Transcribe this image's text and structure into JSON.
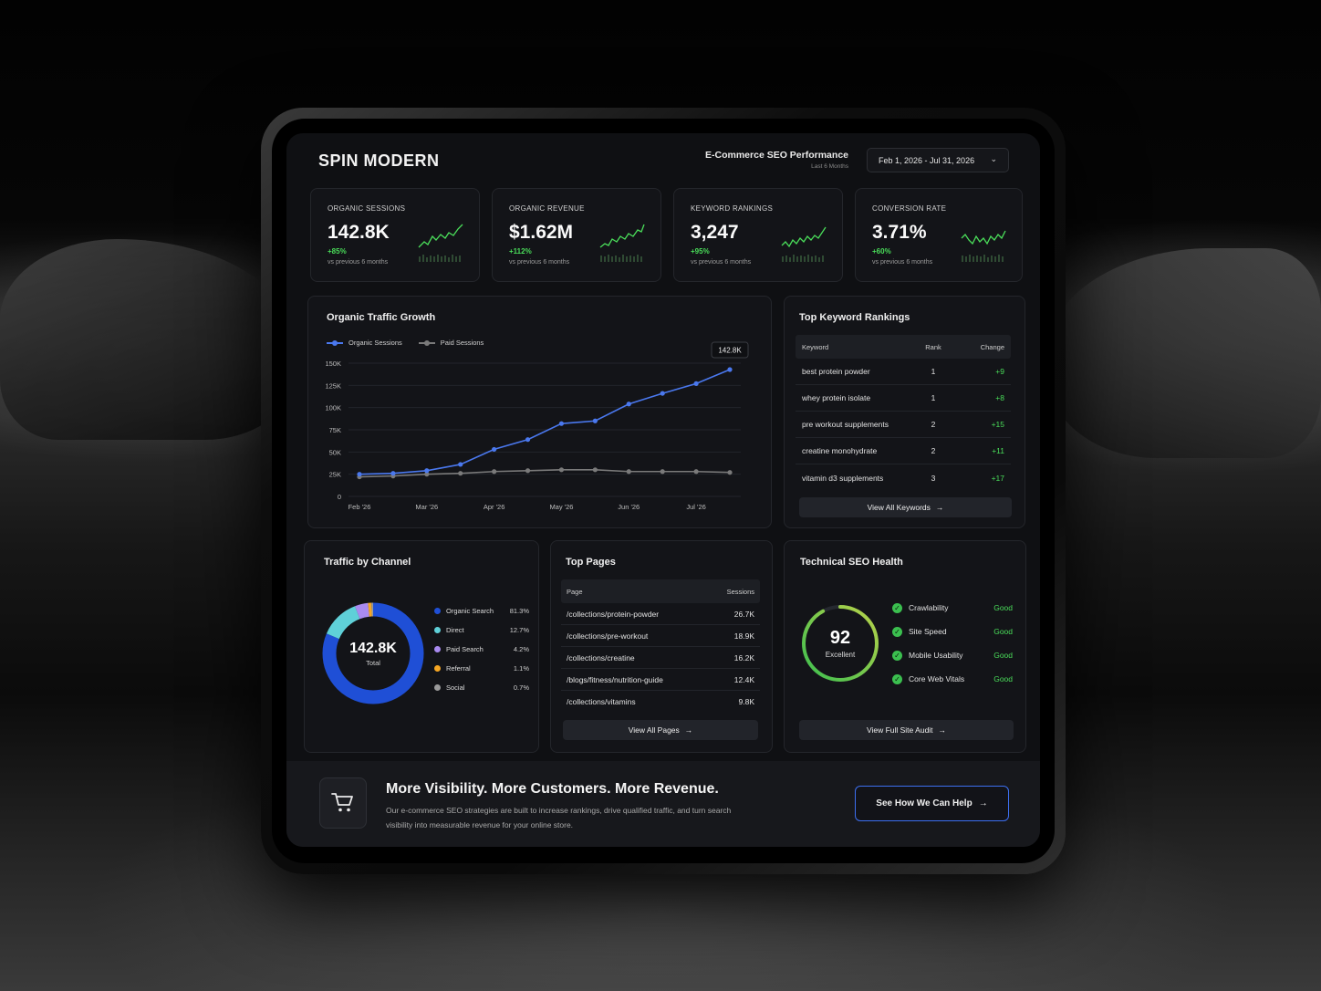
{
  "brand": "SPIN MODERN",
  "header": {
    "title": "E-Commerce SEO Performance",
    "subtitle": "Last 6 Months",
    "date_range": "Feb 1, 2026 - Jul 31, 2026"
  },
  "kpis": [
    {
      "label": "ORGANIC SESSIONS",
      "value": "142.8K",
      "change": "+85%",
      "note": "vs previous 6 months"
    },
    {
      "label": "ORGANIC REVENUE",
      "value": "$1.62M",
      "change": "+112%",
      "note": "vs previous 6 months"
    },
    {
      "label": "KEYWORD RANKINGS",
      "value": "3,247",
      "change": "+95%",
      "note": "vs previous 6 months"
    },
    {
      "label": "CONVERSION RATE",
      "value": "3.71%",
      "change": "+60%",
      "note": "vs previous 6 months"
    }
  ],
  "traffic": {
    "title": "Organic Traffic Growth",
    "tooltip": "142.8K"
  },
  "chart_data": {
    "type": "line",
    "title": "Organic Traffic Growth",
    "x": [
      "Feb '26",
      "",
      "Mar '26",
      "",
      "Apr '26",
      "",
      "May '26",
      "",
      "Jun '26",
      "",
      "Jul '26",
      ""
    ],
    "x_tick_labels": [
      "Feb '26",
      "Mar '26",
      "Apr '26",
      "May '26",
      "Jun '26",
      "Jul '26"
    ],
    "y_tick_labels": [
      "150K",
      "125K",
      "100K",
      "75K",
      "50K",
      "25K",
      "0"
    ],
    "ylim": [
      0,
      150000
    ],
    "series": [
      {
        "name": "Organic Sessions",
        "color": "#4a78ee",
        "values": [
          25000,
          26000,
          29000,
          36000,
          53000,
          64000,
          82000,
          85000,
          104000,
          116000,
          127000,
          142800
        ]
      },
      {
        "name": "Paid Sessions",
        "color": "#7a7a7a",
        "values": [
          22000,
          23000,
          25000,
          26000,
          28000,
          29000,
          30000,
          30000,
          28000,
          28000,
          28000,
          27000
        ]
      }
    ],
    "grid": true,
    "legend": "top-left"
  },
  "keywords": {
    "title": "Top Keyword Rankings",
    "headers": [
      "Keyword",
      "Rank",
      "Change"
    ],
    "rows": [
      {
        "keyword": "best protein powder",
        "rank": "1",
        "change": "+9"
      },
      {
        "keyword": "whey protein isolate",
        "rank": "1",
        "change": "+8"
      },
      {
        "keyword": "pre workout supplements",
        "rank": "2",
        "change": "+15"
      },
      {
        "keyword": "creatine monohydrate",
        "rank": "2",
        "change": "+11"
      },
      {
        "keyword": "vitamin d3 supplements",
        "rank": "3",
        "change": "+17"
      }
    ],
    "button": "View All Keywords"
  },
  "channels": {
    "title": "Traffic by Channel",
    "total": "142.8K",
    "total_label": "Total",
    "items": [
      {
        "name": "Organic Search",
        "pct": "81.3%",
        "value": 81.3,
        "color": "#1f4fd6"
      },
      {
        "name": "Direct",
        "pct": "12.7%",
        "value": 12.7,
        "color": "#5fd0d8"
      },
      {
        "name": "Paid Search",
        "pct": "4.2%",
        "value": 4.2,
        "color": "#a98af0"
      },
      {
        "name": "Referral",
        "pct": "1.1%",
        "value": 1.1,
        "color": "#f5a623"
      },
      {
        "name": "Social",
        "pct": "0.7%",
        "value": 0.7,
        "color": "#9a9a9a"
      }
    ]
  },
  "pages": {
    "title": "Top Pages",
    "headers": [
      "Page",
      "Sessions"
    ],
    "rows": [
      {
        "page": "/collections/protein-powder",
        "sessions": "26.7K"
      },
      {
        "page": "/collections/pre-workout",
        "sessions": "18.9K"
      },
      {
        "page": "/collections/creatine",
        "sessions": "16.2K"
      },
      {
        "page": "/blogs/fitness/nutrition-guide",
        "sessions": "12.4K"
      },
      {
        "page": "/collections/vitamins",
        "sessions": "9.8K"
      }
    ],
    "button": "View All Pages"
  },
  "health": {
    "title": "Technical SEO Health",
    "score": "92",
    "score_value": 92,
    "score_label": "Excellent",
    "items": [
      {
        "name": "Crawlability",
        "status": "Good"
      },
      {
        "name": "Site Speed",
        "status": "Good"
      },
      {
        "name": "Mobile Usability",
        "status": "Good"
      },
      {
        "name": "Core Web Vitals",
        "status": "Good"
      }
    ],
    "button": "View Full Site Audit"
  },
  "footer": {
    "title": "More Visibility. More Customers. More Revenue.",
    "text": "Our e-commerce SEO strategies are built to increase rankings, drive qualified traffic, and turn search visibility into measurable revenue for your online store.",
    "cta": "See How We Can Help"
  },
  "colors": {
    "accent": "#4a78ee",
    "positive": "#4ade5a",
    "background": "#0f1013"
  }
}
